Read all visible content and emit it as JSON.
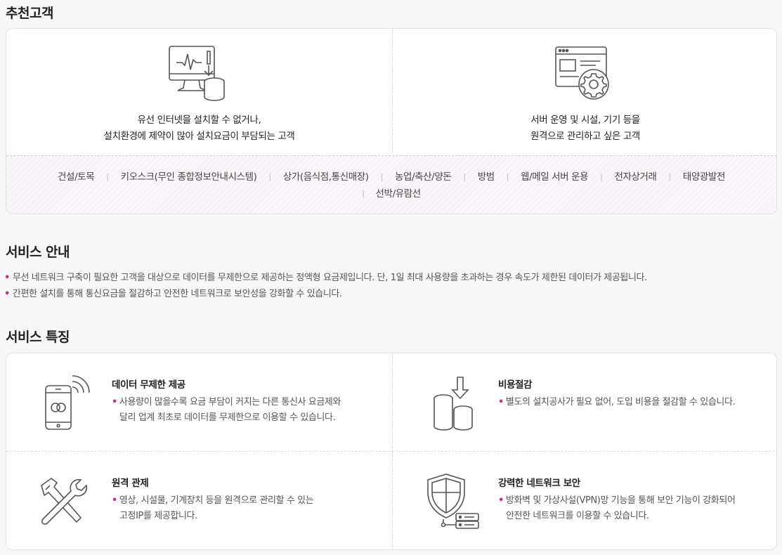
{
  "recommend": {
    "title": "추천고객",
    "left": {
      "icon": "monitor-database-icon",
      "line1": "유선 인터넷을 설치할 수 없거나,",
      "line2": "설치환경에 제약이 많아 설치요금이 부담되는 고객"
    },
    "right": {
      "icon": "browser-gear-icon",
      "line1": "서버 운영 및 시설, 기기 등을",
      "line2": "원격으로 관리하고 싶은 고객"
    },
    "tags_row1": [
      "건설/토목",
      "키오스크(무인 종합정보안내시스템)",
      "상가(음식점,통신매장)",
      "농업/축산/양돈",
      "방범",
      "웹/메일 서버 운용",
      "전자상거래",
      "태양광발전"
    ],
    "tags_row2": [
      "선박/유람선"
    ]
  },
  "service_guide": {
    "title": "서비스 안내",
    "bullets": [
      "무선 네트워크 구축이 필요한 고객을 대상으로 데이터를 무제한으로 제공하는 정액형 요금제입니다. 단, 1일 최대 사용량을 초과하는 경우 속도가 제한된 데이터가 제공됩니다.",
      "간편한 설치를 통해 통신요금을 절감하고 안전한 네트워크로 보안성을 강화할 수 있습니다."
    ]
  },
  "features": {
    "title": "서비스 특징",
    "items": [
      {
        "icon": "mobile-signal-icon",
        "title": "데이터 무제한 제공",
        "desc_line1": "사용량이 많을수록 요금 부담이 커지는 다른 통신사 요금제와",
        "desc_line2": "달리 업계 최초로 데이터를 무제한으로 이용할 수 있습니다."
      },
      {
        "icon": "coins-download-icon",
        "title": "비용절감",
        "desc_line1": "별도의 설치공사가 필요 없어, 도입 비용을 절감할 수 있습니다.",
        "desc_line2": ""
      },
      {
        "icon": "tools-icon",
        "title": "원격 관제",
        "desc_line1": "영상, 시설물, 기계장치 등을 원격으로 관리할 수 있는",
        "desc_line2": "고정IP를 제공합니다."
      },
      {
        "icon": "shield-server-icon",
        "title": "강력한 네트워크 보안",
        "desc_line1": "방화벽 및 가상사설(VPN)망 기능을 통해 보안 기능이 강화되어",
        "desc_line2": "안전한 네트워크를 이용할 수 있습니다."
      }
    ]
  },
  "colors": {
    "accent": "#c0338a",
    "tag_bg": "#f8f1f7"
  }
}
